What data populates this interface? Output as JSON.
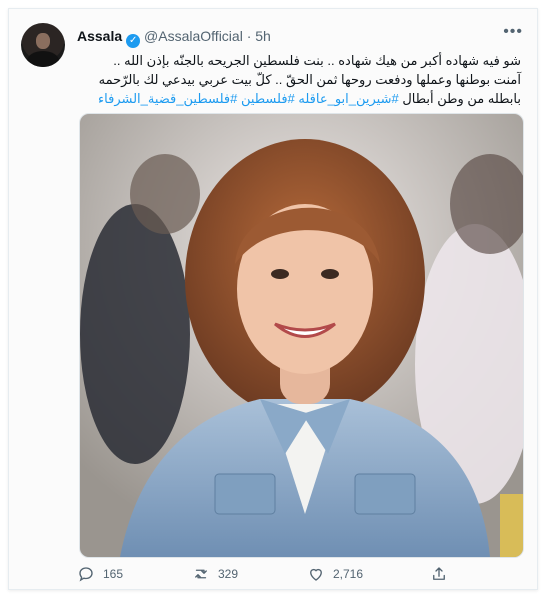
{
  "tweet": {
    "author_name": "Assala",
    "handle": "@AssalaOfficial",
    "separator": "·",
    "time": "5h",
    "more_icon": "more-horizontal-icon",
    "verified_icon": "verified-badge-icon",
    "text_line_1": "شو فيه شهاده أكبر من هيك شهاده .. بنت فلسطين الجريحه بالجنّه بإذن الله ..",
    "text_line_2": "آمنت بوطنها وعملها ودفعت روحها ثمن الحقّ .. كلّ بيت عربي بيدعي لك بالرّحمه",
    "text_line_3_plain": "بابطله من وطن أبطال ",
    "text_line_3_hashtags": "#شيرين_ابو_عاقله #فلسطين #فلسطين_قضية_الشرفاء",
    "media_alt": "photo"
  },
  "actions": {
    "reply_count": "165",
    "retweet_count": "329",
    "like_count": "2,716",
    "reply_icon": "reply-icon",
    "retweet_icon": "retweet-icon",
    "like_icon": "heart-icon",
    "share_icon": "share-icon"
  },
  "colors": {
    "accent": "#1d9bf0",
    "muted": "#536471",
    "text": "#0f1419"
  }
}
